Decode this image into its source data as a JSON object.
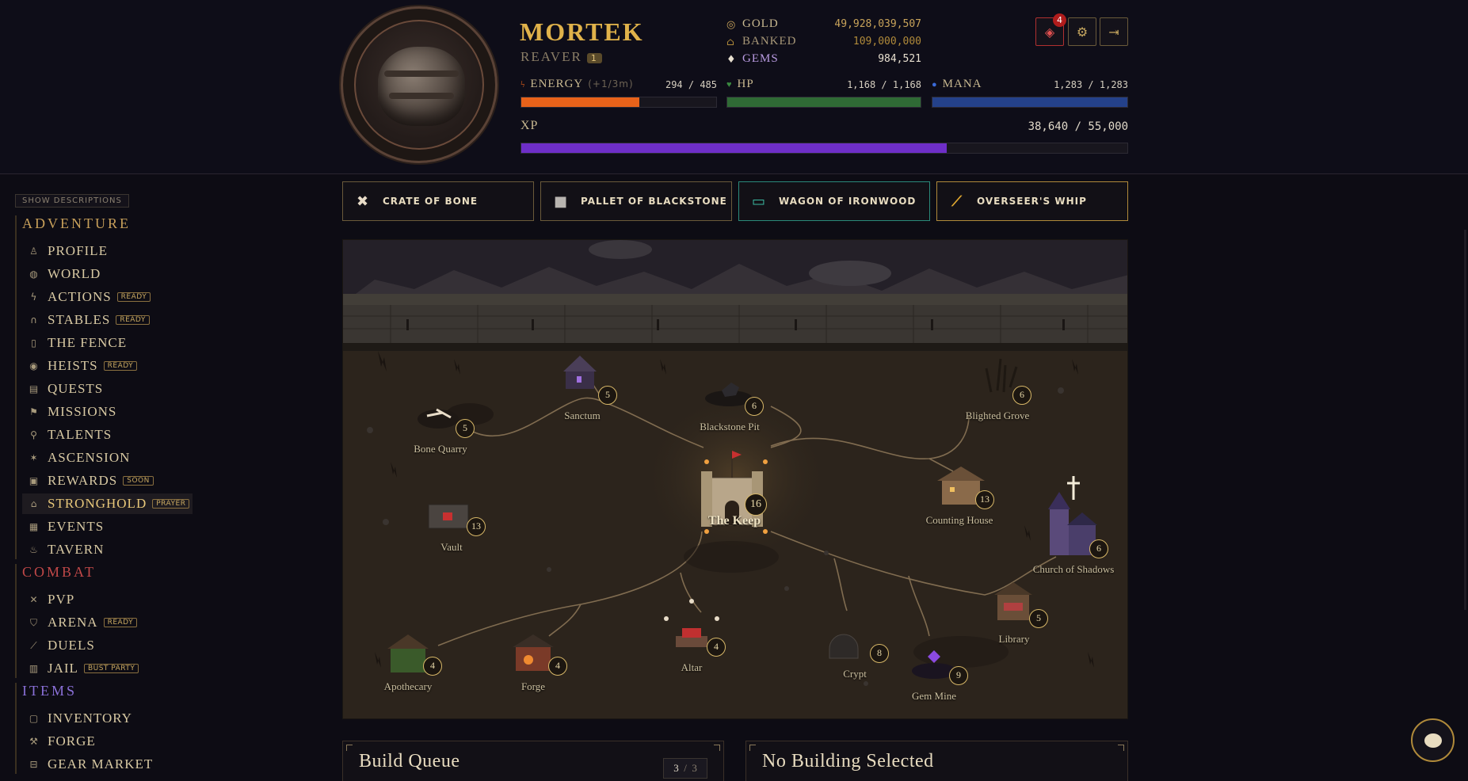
{
  "hero": {
    "name": "MORTEK",
    "class": "REAVER",
    "level": "1"
  },
  "currencies": [
    {
      "icon": "gold-coin-icon",
      "label": "GOLD",
      "value": "49,928,039,507",
      "color": "#c8a35a",
      "label_color": "#c8b890"
    },
    {
      "icon": "bank-icon",
      "label": "BANKED",
      "value": "109,000,000",
      "color": "#b08a3a",
      "label_color": "#a89878"
    },
    {
      "icon": "gem-icon",
      "label": "GEMS",
      "value": "984,521",
      "color": "#e8e0d0",
      "label_color": "#b89ae0"
    }
  ],
  "stats": {
    "energy": {
      "label": "ENERGY",
      "rate": "(+1/3m)",
      "value": "294 / 485",
      "fraction": 0.606,
      "color": "#e8621a"
    },
    "hp": {
      "label": "HP",
      "value": "1,168 / 1,168",
      "fraction": 1.0,
      "color": "#2f6a35"
    },
    "mana": {
      "label": "MANA",
      "value": "1,283 / 1,283",
      "fraction": 1.0,
      "color": "#24418a"
    },
    "xp": {
      "label": "XP",
      "value": "38,640 / 55,000",
      "fraction": 0.7025,
      "color": "#6e2ec8"
    }
  },
  "header_buttons": {
    "notifications_count": "4"
  },
  "sidebar": {
    "show_descriptions": "SHOW DESCRIPTIONS",
    "sections": [
      {
        "title": "ADVENTURE",
        "color": "#c8a05a",
        "items": [
          {
            "icon": "profile-icon",
            "glyph": "♙",
            "label": "PROFILE",
            "badge": ""
          },
          {
            "icon": "globe-icon",
            "glyph": "◍",
            "label": "WORLD",
            "badge": ""
          },
          {
            "icon": "lightning-icon",
            "glyph": "ϟ",
            "label": "ACTIONS",
            "badge": "READY"
          },
          {
            "icon": "horseshoe-icon",
            "glyph": "∩",
            "label": "STABLES",
            "badge": "READY"
          },
          {
            "icon": "lock-icon",
            "glyph": "▯",
            "label": "THE FENCE",
            "badge": ""
          },
          {
            "icon": "eye-icon",
            "glyph": "◉",
            "label": "HEISTS",
            "badge": "READY"
          },
          {
            "icon": "scroll-icon",
            "glyph": "▤",
            "label": "QUESTS",
            "badge": ""
          },
          {
            "icon": "flag-icon",
            "glyph": "⚑",
            "label": "MISSIONS",
            "badge": ""
          },
          {
            "icon": "talent-icon",
            "glyph": "⚲",
            "label": "TALENTS",
            "badge": ""
          },
          {
            "icon": "star-icon",
            "glyph": "✶",
            "label": "ASCENSION",
            "badge": ""
          },
          {
            "icon": "gift-icon",
            "glyph": "▣",
            "label": "REWARDS",
            "badge": "SOON"
          },
          {
            "icon": "castle-icon",
            "glyph": "⌂",
            "label": "STRONGHOLD",
            "badge": "PRAYER",
            "active": true
          },
          {
            "icon": "calendar-icon",
            "glyph": "▦",
            "label": "EVENTS",
            "badge": ""
          },
          {
            "icon": "mug-icon",
            "glyph": "♨",
            "label": "TAVERN",
            "badge": ""
          }
        ]
      },
      {
        "title": "COMBAT",
        "color": "#c04848",
        "items": [
          {
            "icon": "crossed-swords-icon",
            "glyph": "✕",
            "label": "PVP",
            "badge": ""
          },
          {
            "icon": "shield-icon",
            "glyph": "⛉",
            "label": "ARENA",
            "badge": "READY"
          },
          {
            "icon": "sword-icon",
            "glyph": "⟋",
            "label": "DUELS",
            "badge": ""
          },
          {
            "icon": "jail-bars-icon",
            "glyph": "▥",
            "label": "JAIL",
            "badge": "BUST PARTY"
          }
        ]
      },
      {
        "title": "ITEMS",
        "color": "#8a70d8",
        "items": [
          {
            "icon": "backpack-icon",
            "glyph": "▢",
            "label": "INVENTORY",
            "badge": ""
          },
          {
            "icon": "anvil-icon",
            "glyph": "⚒",
            "label": "FORGE",
            "badge": ""
          },
          {
            "icon": "shop-icon",
            "glyph": "⊟",
            "label": "GEAR MARKET",
            "badge": ""
          }
        ]
      }
    ]
  },
  "consumables": [
    {
      "icon": "bone-icon",
      "label": "CRATE OF BONE",
      "style": "gold-dim"
    },
    {
      "icon": "stone-block-icon",
      "label": "PALLET OF BLACKSTONE",
      "style": "gold-dim"
    },
    {
      "icon": "wagon-icon",
      "label": "WAGON OF IRONWOOD",
      "style": "teal"
    },
    {
      "icon": "whip-icon",
      "label": "OVERSEER'S WHIP",
      "style": "gold"
    }
  ],
  "map": {
    "buildings": [
      {
        "name": "Sanctum",
        "level": "5"
      },
      {
        "name": "Blackstone Pit",
        "level": "6"
      },
      {
        "name": "Blighted Grove",
        "level": "6"
      },
      {
        "name": "Bone Quarry",
        "level": "5"
      },
      {
        "name": "The Keep",
        "level": "16"
      },
      {
        "name": "Counting House",
        "level": "13"
      },
      {
        "name": "Church of Shadows",
        "level": "6"
      },
      {
        "name": "Vault",
        "level": "13"
      },
      {
        "name": "Library",
        "level": "5"
      },
      {
        "name": "Apothecary",
        "level": "4"
      },
      {
        "name": "Forge",
        "level": "4"
      },
      {
        "name": "Altar",
        "level": "4"
      },
      {
        "name": "Crypt",
        "level": "8"
      },
      {
        "name": "Gem Mine",
        "level": "9"
      }
    ]
  },
  "build_queue": {
    "title": "Build Queue",
    "used": "3",
    "total": "3"
  },
  "selection_panel": {
    "title": "No Building Selected"
  }
}
